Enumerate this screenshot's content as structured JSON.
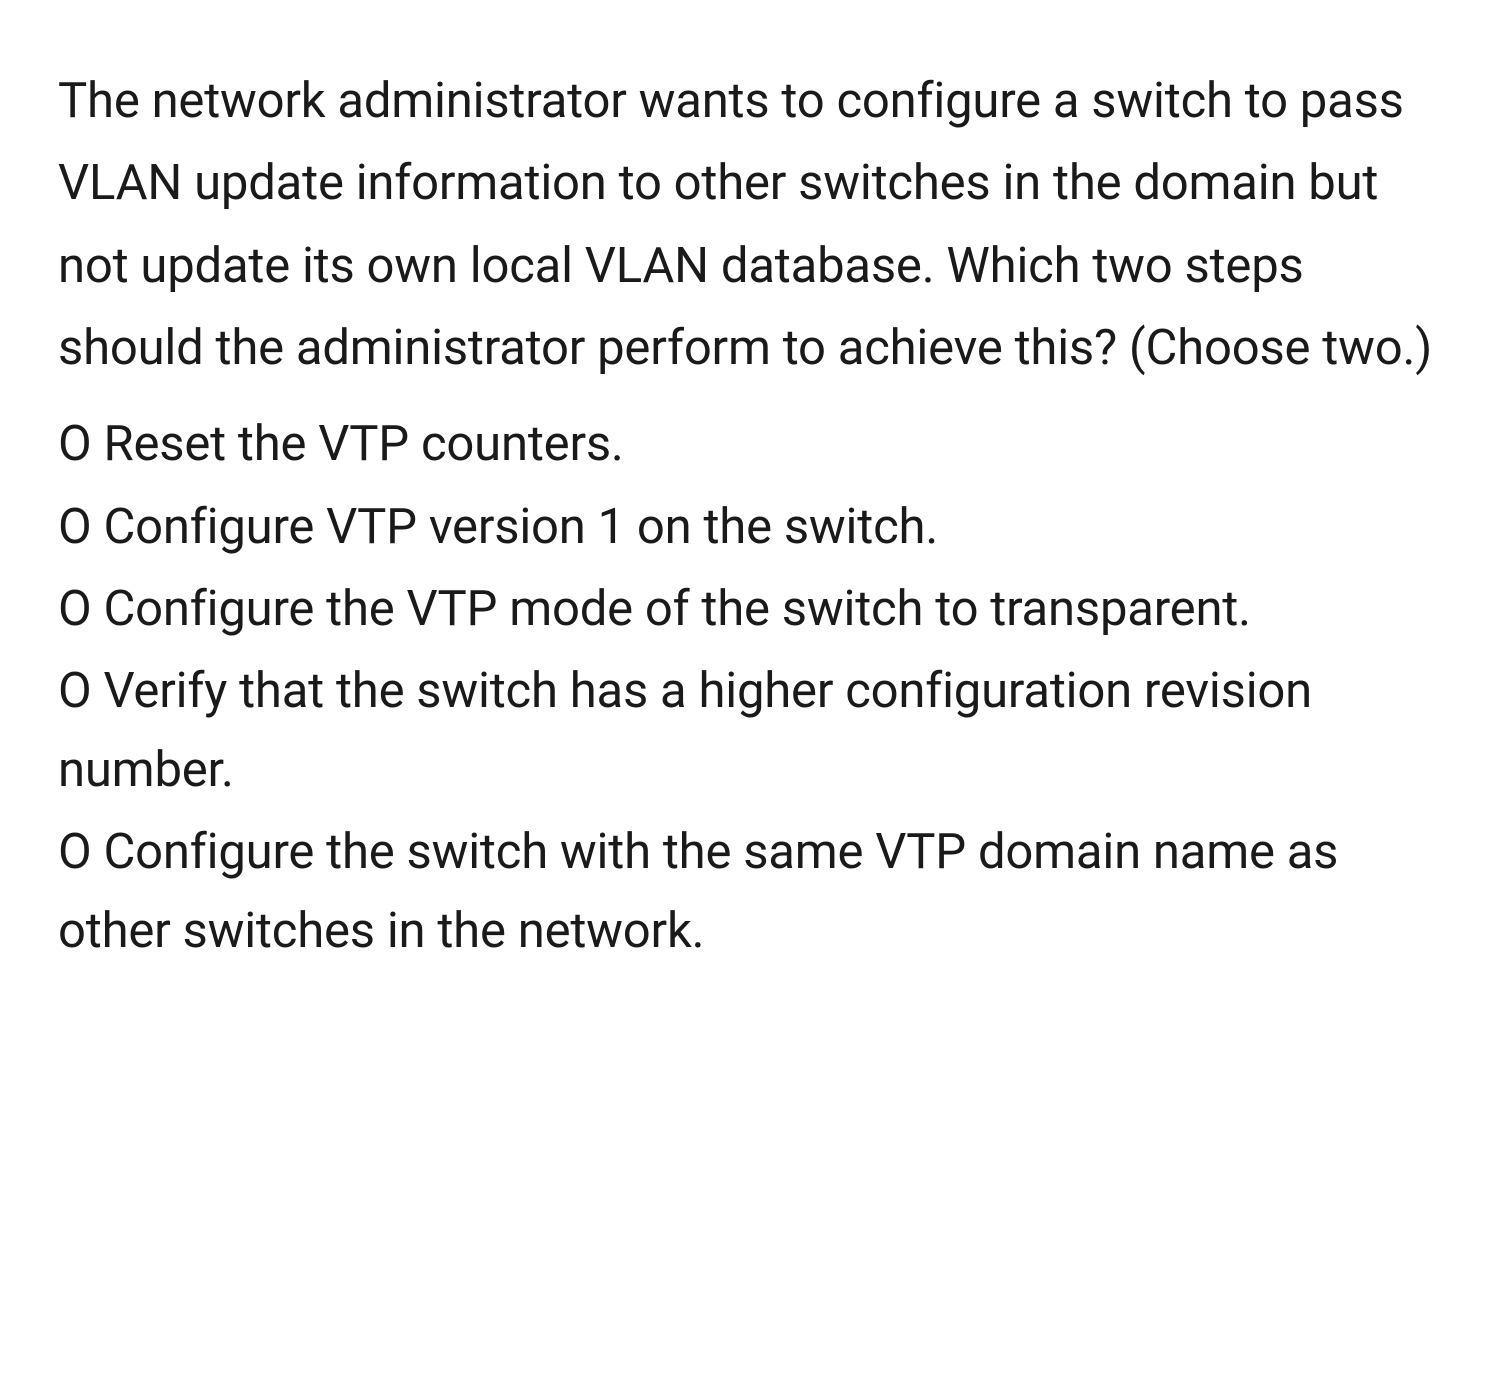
{
  "question": {
    "text": "The network administrator wants to configure a switch to pass VLAN update information to other switches in the domain but not update its own local VLAN database. Which two steps should the administrator perform to achieve this? (Choose two.)"
  },
  "options": [
    {
      "marker": "O",
      "label": "Reset the VTP counters."
    },
    {
      "marker": "O",
      "label": "Configure VTP version 1 on the switch."
    },
    {
      "marker": "O",
      "label": "Configure the VTP mode of the switch to transparent."
    },
    {
      "marker": "O",
      "label": "Verify that the switch has a higher configuration revision number."
    },
    {
      "marker": "O",
      "label": "Configure the switch with the same VTP domain name as other switches in the network."
    }
  ]
}
